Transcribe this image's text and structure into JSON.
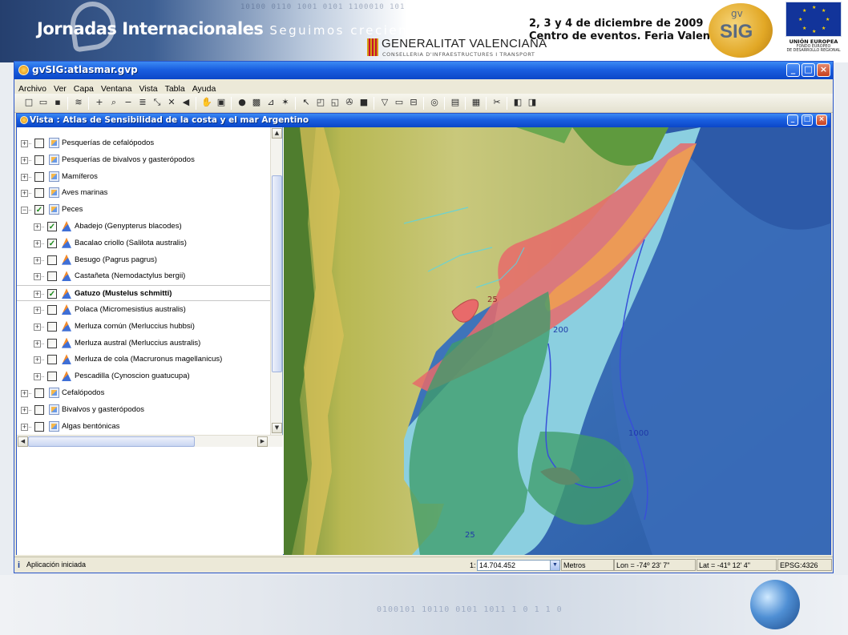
{
  "banner": {
    "title": "Jornadas Internacionales",
    "tagline": "Seguimos creciendo",
    "binary": "10100 0110 1001 0101 1100010 101",
    "generalitat": "GENERALITAT VALENCIANA",
    "conselleria": "CONSELLERIA D'INFRAESTRUCTURES I TRANSPORT",
    "event_date": "2, 3 y 4 de diciembre de 2009",
    "event_place": "Centro de eventos. Feria Valencia",
    "gvsig_gv": "gv",
    "gvsig_logo_text": "SIG",
    "eu_title": "UNIÓN EUROPEA",
    "eu_fund_1": "FONDO EUROPEO",
    "eu_fund_2": "DE DESARROLLO REGIONAL"
  },
  "window": {
    "title": "gvSIG:atlasmar.gvp",
    "minimize": "_",
    "maximize": "□",
    "close": "×"
  },
  "menu": [
    "Archivo",
    "Ver",
    "Capa",
    "Ventana",
    "Vista",
    "Tabla",
    "Ayuda"
  ],
  "toolbar_icons": [
    {
      "name": "new-file-icon",
      "glyph": "□"
    },
    {
      "name": "open-folder-icon",
      "glyph": "▭"
    },
    {
      "name": "save-icon",
      "glyph": "▪"
    },
    {
      "name": "layers-icon",
      "glyph": "≋"
    },
    {
      "name": "zoom-in-icon",
      "glyph": "+"
    },
    {
      "name": "zoom-select-icon",
      "glyph": "⌕"
    },
    {
      "name": "zoom-out-icon",
      "glyph": "−"
    },
    {
      "name": "zoom-layer-icon",
      "glyph": "≣"
    },
    {
      "name": "zoom-shrink-icon",
      "glyph": "⤡"
    },
    {
      "name": "full-extent-icon",
      "glyph": "✕"
    },
    {
      "name": "previous-extent-icon",
      "glyph": "◀"
    },
    {
      "name": "pan-hand-icon",
      "glyph": "✋"
    },
    {
      "name": "locator-icon",
      "glyph": "▣"
    },
    {
      "name": "info-icon",
      "glyph": "●"
    },
    {
      "name": "measure-area-icon",
      "glyph": "▩"
    },
    {
      "name": "measure-distance-icon",
      "glyph": "⊿"
    },
    {
      "name": "hyperlink-icon",
      "glyph": "✶"
    },
    {
      "name": "select-pointer-icon",
      "glyph": "↖"
    },
    {
      "name": "select-rectangle-icon",
      "glyph": "◰"
    },
    {
      "name": "select-polygon-icon",
      "glyph": "◱"
    },
    {
      "name": "select-layer-icon",
      "glyph": "✇"
    },
    {
      "name": "clear-selection-icon",
      "glyph": "■"
    },
    {
      "name": "filter-icon",
      "glyph": "▽"
    },
    {
      "name": "table-icon",
      "glyph": "▭"
    },
    {
      "name": "attributes-icon",
      "glyph": "⊟"
    },
    {
      "name": "search-layer-icon",
      "glyph": "◎"
    },
    {
      "name": "legend-icon",
      "glyph": "▤"
    },
    {
      "name": "print-icon",
      "glyph": "▦"
    },
    {
      "name": "tools-icon",
      "glyph": "✂"
    },
    {
      "name": "edit-start-icon",
      "glyph": "◧"
    },
    {
      "name": "edit-stop-icon",
      "glyph": "◨"
    }
  ],
  "view": {
    "title": "Vista : Atlas de Sensibilidad de la costa y el mar Argentino"
  },
  "toc": {
    "nodes": [
      {
        "label": "Pesquerías de cefalópodos",
        "level": 0,
        "expander": "+",
        "checked": false,
        "icon": "folder"
      },
      {
        "label": "Pesquerías de bivalvos y gasterópodos",
        "level": 0,
        "expander": "+",
        "checked": false,
        "icon": "folder"
      },
      {
        "label": "Mamíferos",
        "level": 0,
        "expander": "+",
        "checked": false,
        "icon": "folder"
      },
      {
        "label": "Aves marinas",
        "level": 0,
        "expander": "+",
        "checked": false,
        "icon": "folder"
      },
      {
        "label": "Peces",
        "level": 0,
        "expander": "−",
        "checked": true,
        "icon": "folder"
      },
      {
        "label": "Abadejo (Genypterus blacodes)",
        "level": 1,
        "expander": "+",
        "checked": true,
        "icon": "layer"
      },
      {
        "label": "Bacalao criollo (Salilota australis)",
        "level": 1,
        "expander": "+",
        "checked": true,
        "icon": "layer"
      },
      {
        "label": "Besugo (Pagrus pagrus)",
        "level": 1,
        "expander": "+",
        "checked": false,
        "icon": "layer"
      },
      {
        "label": "Castañeta (Nemodactylus bergii)",
        "level": 1,
        "expander": "+",
        "checked": false,
        "icon": "layer"
      },
      {
        "label": "Gatuzo (Mustelus schmitti)",
        "level": 1,
        "expander": "+",
        "checked": true,
        "icon": "layer",
        "selected": true
      },
      {
        "label": "Polaca (Micromesistius australis)",
        "level": 1,
        "expander": "+",
        "checked": false,
        "icon": "layer"
      },
      {
        "label": "Merluza común (Merluccius hubbsi)",
        "level": 1,
        "expander": "+",
        "checked": false,
        "icon": "layer"
      },
      {
        "label": "Merluza austral (Merluccius australis)",
        "level": 1,
        "expander": "+",
        "checked": false,
        "icon": "layer"
      },
      {
        "label": "Merluza de cola (Macruronus magellanicus)",
        "level": 1,
        "expander": "+",
        "checked": false,
        "icon": "layer"
      },
      {
        "label": "Pescadilla (Cynoscion guatucupa)",
        "level": 1,
        "expander": "+",
        "checked": false,
        "icon": "layer"
      },
      {
        "label": "Cefalópodos",
        "level": 0,
        "expander": "+",
        "checked": false,
        "icon": "folder"
      },
      {
        "label": "Bivalvos y gasterópodos",
        "level": 0,
        "expander": "+",
        "checked": false,
        "icon": "folder"
      },
      {
        "label": "Algas bentónicas",
        "level": 0,
        "expander": "+",
        "checked": false,
        "icon": "folder"
      }
    ],
    "scroll_up": "▲",
    "scroll_down": "▼",
    "scroll_left": "◀",
    "scroll_right": "▶"
  },
  "map": {
    "isobath_labels": [
      "25",
      "200",
      "1000",
      "25"
    ]
  },
  "status": {
    "message": "Aplicación iniciada",
    "scale_prefix": "1:",
    "scale_value": "14.704.452",
    "scale_dropdown": "▼",
    "units": "Metros",
    "lon": "Lon = -74º 23' 7\"",
    "lat": "Lat = -41º 12' 4\"",
    "epsg": "EPSG:4326"
  },
  "footer": {
    "binary": "0100101 10110 0101 1011 1 0 1 1 0"
  },
  "colors": {
    "xp_title": "#0b47c8",
    "ocean_deep": "#2f62b3",
    "shelf": "#8fd3d4",
    "land": "#c7c66e",
    "species_red": "#e86a6a",
    "species_green": "#3f9c6a",
    "isobath": "#3850d8"
  }
}
